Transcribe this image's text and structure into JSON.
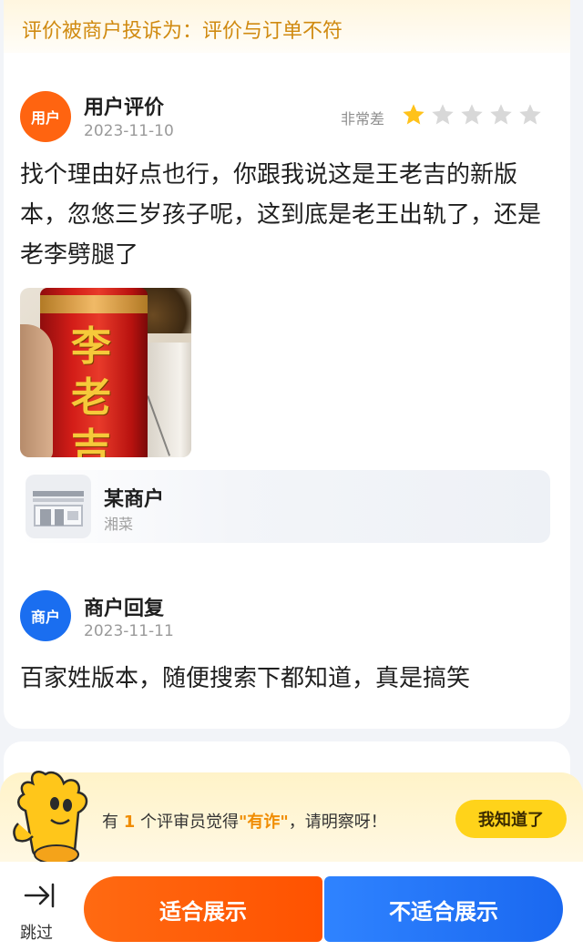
{
  "complaint": {
    "text": "评价被商户投诉为：评价与订单不符"
  },
  "review": {
    "avatar_label": "用户",
    "title": "用户评价",
    "date": "2023-11-10",
    "rating_label": "非常差",
    "rating": 1,
    "rating_max": 5,
    "text": "找个理由好点也行，你跟我说这是王老吉的新版本，忽悠三岁孩子呢，这到底是老王出轨了，还是老李劈腿了",
    "photo_chars": [
      "李",
      "老",
      "吉"
    ]
  },
  "merchant": {
    "name": "某商户",
    "category": "湘菜"
  },
  "reply": {
    "avatar_label": "商户",
    "title": "商户回复",
    "date": "2023-11-11",
    "text": "百家姓版本，随便搜索下都知道，真是搞笑"
  },
  "notice": {
    "prefix": "有",
    "count": "1",
    "middle": "个评审员觉得",
    "highlight": "\"有诈\"",
    "suffix": "，请明察呀！",
    "button": "我知道了"
  },
  "actions": {
    "skip": "跳过",
    "show": "适合展示",
    "hide": "不适合展示"
  },
  "colors": {
    "accent_orange": "#ff5a0a",
    "accent_blue": "#1a6ef0",
    "star_active": "#ffc21a",
    "star_inactive": "#d8d8d8"
  },
  "icons": {
    "skip": "skip-arrow-icon",
    "star": "star-icon",
    "shop": "shop-icon",
    "mascot": "mascot-icon"
  }
}
